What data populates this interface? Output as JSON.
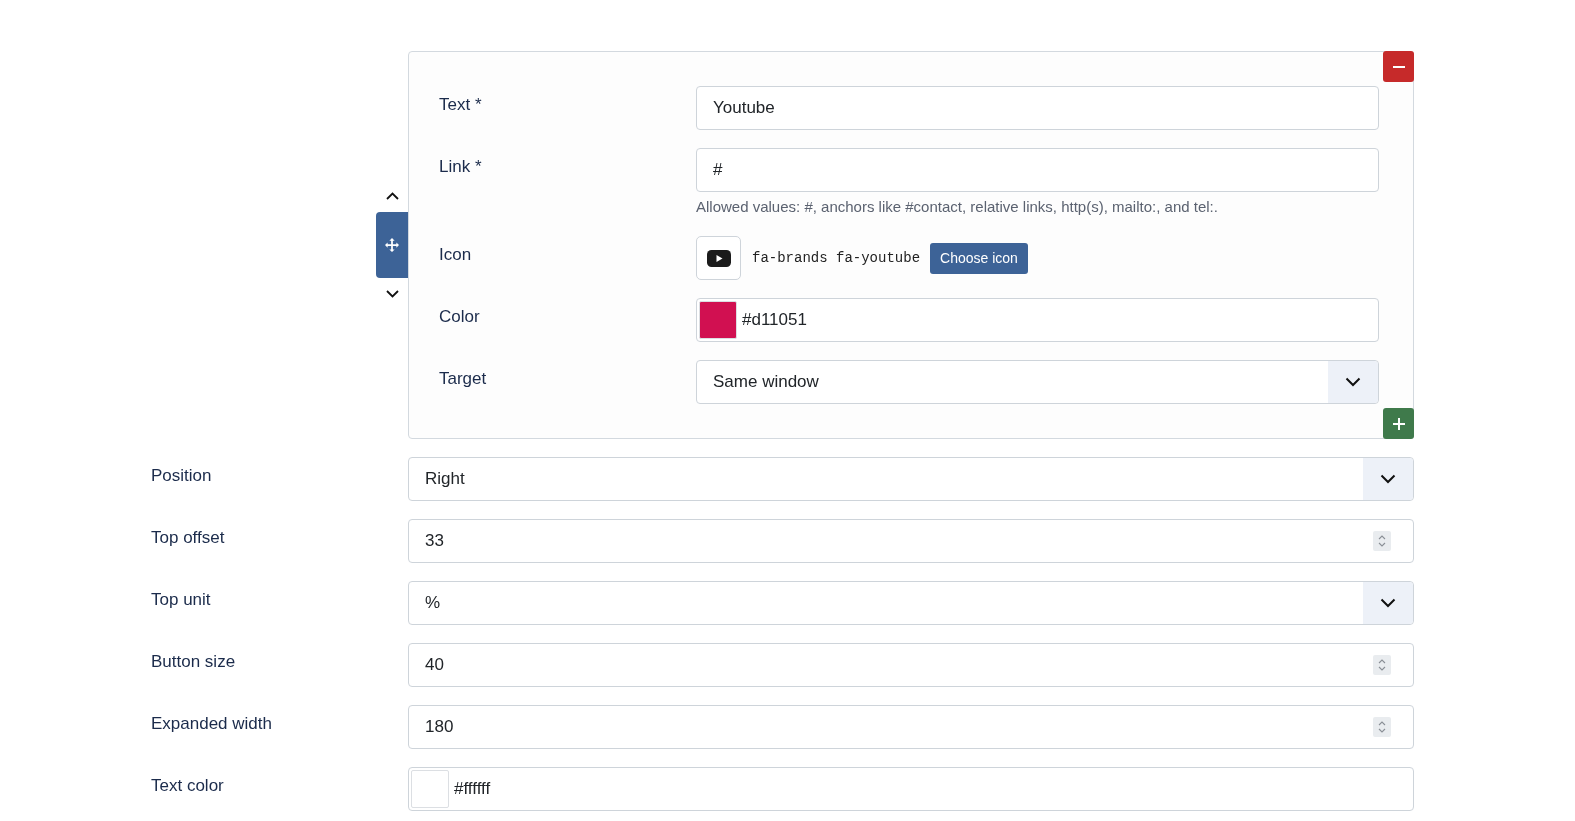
{
  "link_item": {
    "fields": [
      {
        "kind": "text",
        "label": "Text *",
        "value": "Youtube"
      },
      {
        "kind": "text",
        "label": "Link *",
        "value": "#",
        "help": "Allowed values: #, anchors like #contact, relative links, http(s), mailto:, and tel:."
      },
      {
        "kind": "icon",
        "label": "Icon",
        "value": "fa-brands fa-youtube",
        "button": "Choose icon"
      },
      {
        "kind": "color",
        "label": "Color",
        "value": "#d11051",
        "color": "#d11051"
      },
      {
        "kind": "select",
        "label": "Target",
        "value": "Same window"
      }
    ]
  },
  "settings": [
    {
      "kind": "select",
      "label": "Position",
      "value": "Right"
    },
    {
      "kind": "number",
      "label": "Top offset",
      "value": "33"
    },
    {
      "kind": "select",
      "label": "Top unit",
      "value": "%"
    },
    {
      "kind": "number",
      "label": "Button size",
      "value": "40"
    },
    {
      "kind": "number",
      "label": "Expanded width",
      "value": "180"
    },
    {
      "kind": "color",
      "label": "Text color",
      "value": "#ffffff",
      "color": "#ffffff"
    }
  ]
}
